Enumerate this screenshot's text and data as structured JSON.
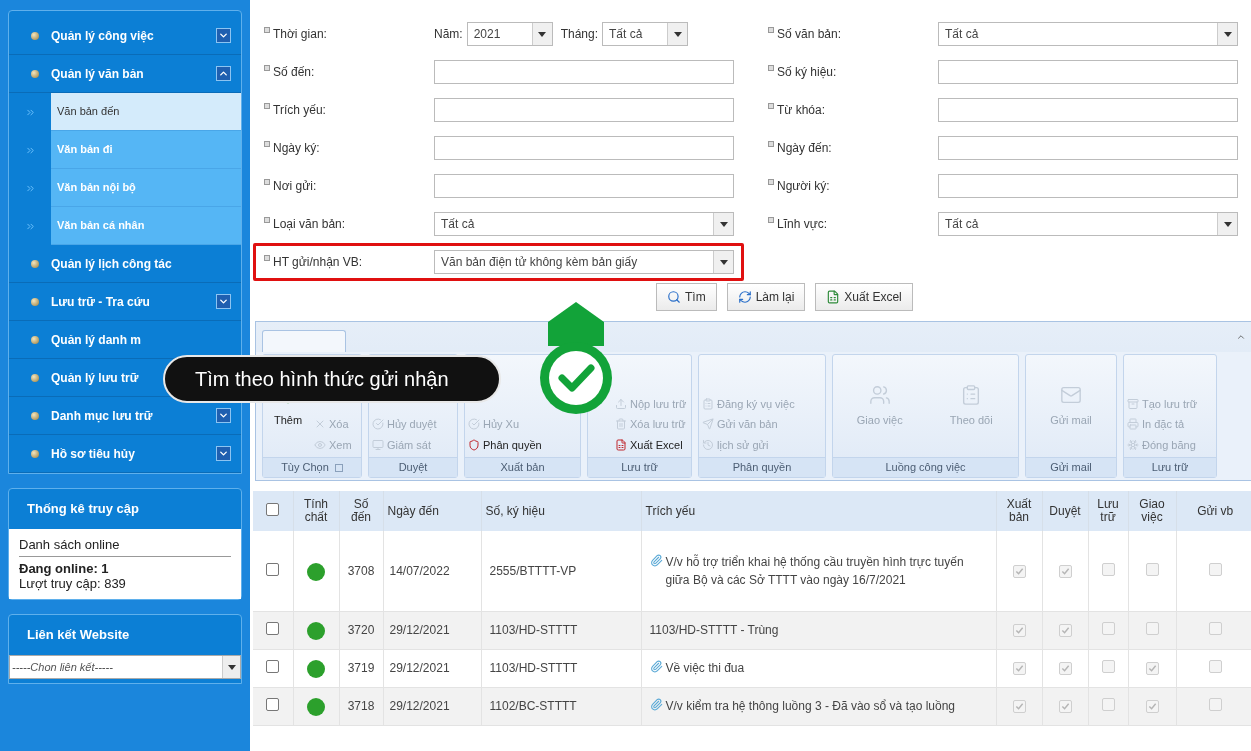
{
  "sidebar": {
    "menu": [
      {
        "label": "Quản lý công việc",
        "expanded": false
      },
      {
        "label": "Quản lý văn bản",
        "expanded": true,
        "children": [
          {
            "label": "Văn bản đến",
            "selected": true
          },
          {
            "label": "Văn bản đi",
            "selected": false
          },
          {
            "label": "Văn bản nội bộ",
            "selected": false
          },
          {
            "label": "Văn bản cá nhân",
            "selected": false
          }
        ]
      },
      {
        "label": "Quản lý lịch công tác"
      },
      {
        "label": "Lưu trữ - Tra cứu",
        "expanded": false
      },
      {
        "label": "Quản lý danh m"
      },
      {
        "label": "Quản lý lưu trữ"
      },
      {
        "label": "Danh mục lưu trữ",
        "expanded": false
      },
      {
        "label": "Hồ sơ tiêu hủy",
        "expanded": false
      }
    ],
    "stats": {
      "title": "Thống kê truy cập",
      "online_list": "Danh sách online",
      "online": "Đang online: 1",
      "visits": "Lượt truy cập: 839"
    },
    "links": {
      "title": "Liên kết Website",
      "value": "-----Chon liên kết-----"
    }
  },
  "search_form": {
    "rows": [
      {
        "left": {
          "kind": "period",
          "label": "Thời gian:",
          "year_label": "Năm:",
          "year": "2021",
          "month_label": "Tháng:",
          "month": "Tất cả"
        },
        "right": {
          "kind": "select",
          "label": "Số văn bản:",
          "value": "Tất cả"
        }
      },
      {
        "left": {
          "kind": "input",
          "label": "Số đến:"
        },
        "right": {
          "kind": "input",
          "label": "Số ký hiệu:"
        }
      },
      {
        "left": {
          "kind": "input",
          "label": "Trích yếu:"
        },
        "right": {
          "kind": "input",
          "label": "Từ khóa:"
        }
      },
      {
        "left": {
          "kind": "input",
          "label": "Ngày ký:"
        },
        "right": {
          "kind": "input",
          "label": "Ngày đến:"
        }
      },
      {
        "left": {
          "kind": "input",
          "label": "Nơi gửi:"
        },
        "right": {
          "kind": "input",
          "label": "Người ký:"
        }
      },
      {
        "left": {
          "kind": "select",
          "label": "Loại văn bản:",
          "value": "Tất cả"
        },
        "right": {
          "kind": "select",
          "label": "Lĩnh vực:",
          "value": "Tất cả"
        }
      },
      {
        "left": {
          "kind": "select",
          "label": "HT gửi/nhận VB:",
          "value": "Văn bản điện tử không kèm bản giấy",
          "highlighted": true
        }
      }
    ],
    "buttons": [
      "Tìm",
      "Làm lại",
      "Xuất Excel"
    ]
  },
  "ribbon": {
    "groups": [
      {
        "title": "Tùy Chọn",
        "launcher": true,
        "large": [
          {
            "label": "Thêm",
            "disabled": false
          }
        ],
        "small": [
          {
            "label": "Xóa",
            "disabled": true
          },
          {
            "label": "Xem",
            "disabled": true
          }
        ]
      },
      {
        "title": "Duyệt",
        "launcher": false,
        "small": [
          {
            "label": "Hủy duyệt",
            "disabled": true
          },
          {
            "label": "Giám sát",
            "disabled": true
          }
        ]
      },
      {
        "title": "Xuất bản",
        "launcher": false,
        "small": [
          {
            "label": "Hủy Xu",
            "disabled": true
          },
          {
            "label": "Phân quyền",
            "disabled": false
          }
        ]
      },
      {
        "title": "Lưu trữ",
        "launcher": false,
        "small": [
          {
            "label": "Nộp lưu trữ",
            "disabled": true
          },
          {
            "label": "Xóa lưu trữ",
            "disabled": true
          },
          {
            "label": "Xuất Excel",
            "disabled": false
          }
        ]
      },
      {
        "title": "Phân quyền",
        "launcher": false,
        "small": [
          {
            "label": "Đăng ký vụ việc",
            "disabled": true
          },
          {
            "label": "Gửi văn bản",
            "disabled": true
          },
          {
            "label": "lịch sử gửi",
            "disabled": true
          }
        ]
      },
      {
        "title": "Luồng công việc",
        "launcher": false,
        "large": [
          {
            "label": "Giao việc",
            "disabled": true
          },
          {
            "label": "Theo dõi",
            "disabled": true
          }
        ]
      },
      {
        "title": "Gửi mail",
        "launcher": false,
        "large": [
          {
            "label": "Gửi mail",
            "disabled": true
          }
        ]
      },
      {
        "title": "Lưu trữ",
        "launcher": false,
        "small": [
          {
            "label": "Tạo lưu trữ",
            "disabled": true
          },
          {
            "label": "In đặc tả",
            "disabled": true
          },
          {
            "label": "Đóng băng",
            "disabled": true
          }
        ]
      }
    ]
  },
  "callout": {
    "text": "Tìm theo hình thức gửi nhận"
  },
  "table": {
    "header_checked": false,
    "columns": [
      "Tính chất",
      "Số đến",
      "Ngày đến",
      "Số, ký hiệu",
      "Trích yếu",
      "Xuất bản",
      "Duyệt",
      "Lưu trữ",
      "Giao việc",
      "Gửi vb"
    ],
    "rows": [
      {
        "checked": false,
        "color": "#2ca02c",
        "number": "3708",
        "date": "14/07/2022",
        "symbol": "2555/BTTTT-VP",
        "attachment": true,
        "summary": "V/v hỗ trợ triển khai hệ thống cầu truyền hình trực tuyến giữa Bộ và các Sở TTTT vào ngày 16/7/2021",
        "flags": [
          true,
          true,
          false,
          false,
          false
        ]
      },
      {
        "checked": false,
        "color": "#2ca02c",
        "number": "3720",
        "date": "29/12/2021",
        "symbol": "1103/HD-STTTT",
        "attachment": false,
        "summary": "1103/HD-STTTT - Trùng",
        "flags": [
          true,
          true,
          false,
          false,
          false
        ]
      },
      {
        "checked": false,
        "color": "#2ca02c",
        "number": "3719",
        "date": "29/12/2021",
        "symbol": "1103/HD-STTTT",
        "attachment": true,
        "summary": "Về việc thi đua",
        "flags": [
          true,
          true,
          false,
          true,
          false
        ]
      },
      {
        "checked": false,
        "color": "#2ca02c",
        "number": "3718",
        "date": "29/12/2021",
        "symbol": "1102/BC-STTTT",
        "attachment": true,
        "summary": "V/v kiểm tra hệ thông luồng 3 - Đã vào sổ và tạo luồng",
        "flags": [
          true,
          true,
          false,
          true,
          false
        ]
      }
    ]
  }
}
